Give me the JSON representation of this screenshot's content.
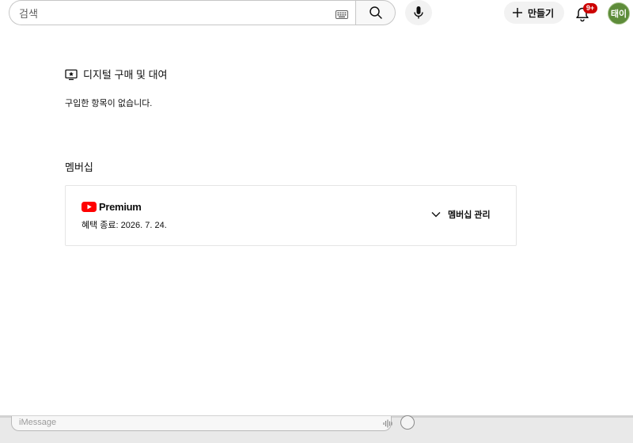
{
  "header": {
    "search_placeholder": "검색",
    "create_label": "만들기",
    "notification_count": "9+",
    "avatar_text": "태이"
  },
  "purchases": {
    "title": "디지털 구매 및 대여",
    "empty_message": "구입한 항목이 없습니다."
  },
  "membership": {
    "heading": "멤버십",
    "product_name": "Premium",
    "benefit_end": "혜택 종료: 2026. 7. 24.",
    "manage_label": "멤버십 관리"
  },
  "bottom": {
    "message_placeholder": "iMessage"
  },
  "colors": {
    "youtube_red": "#ff0000",
    "badge_red": "#cc0000",
    "avatar_green": "#5e8c3a"
  }
}
